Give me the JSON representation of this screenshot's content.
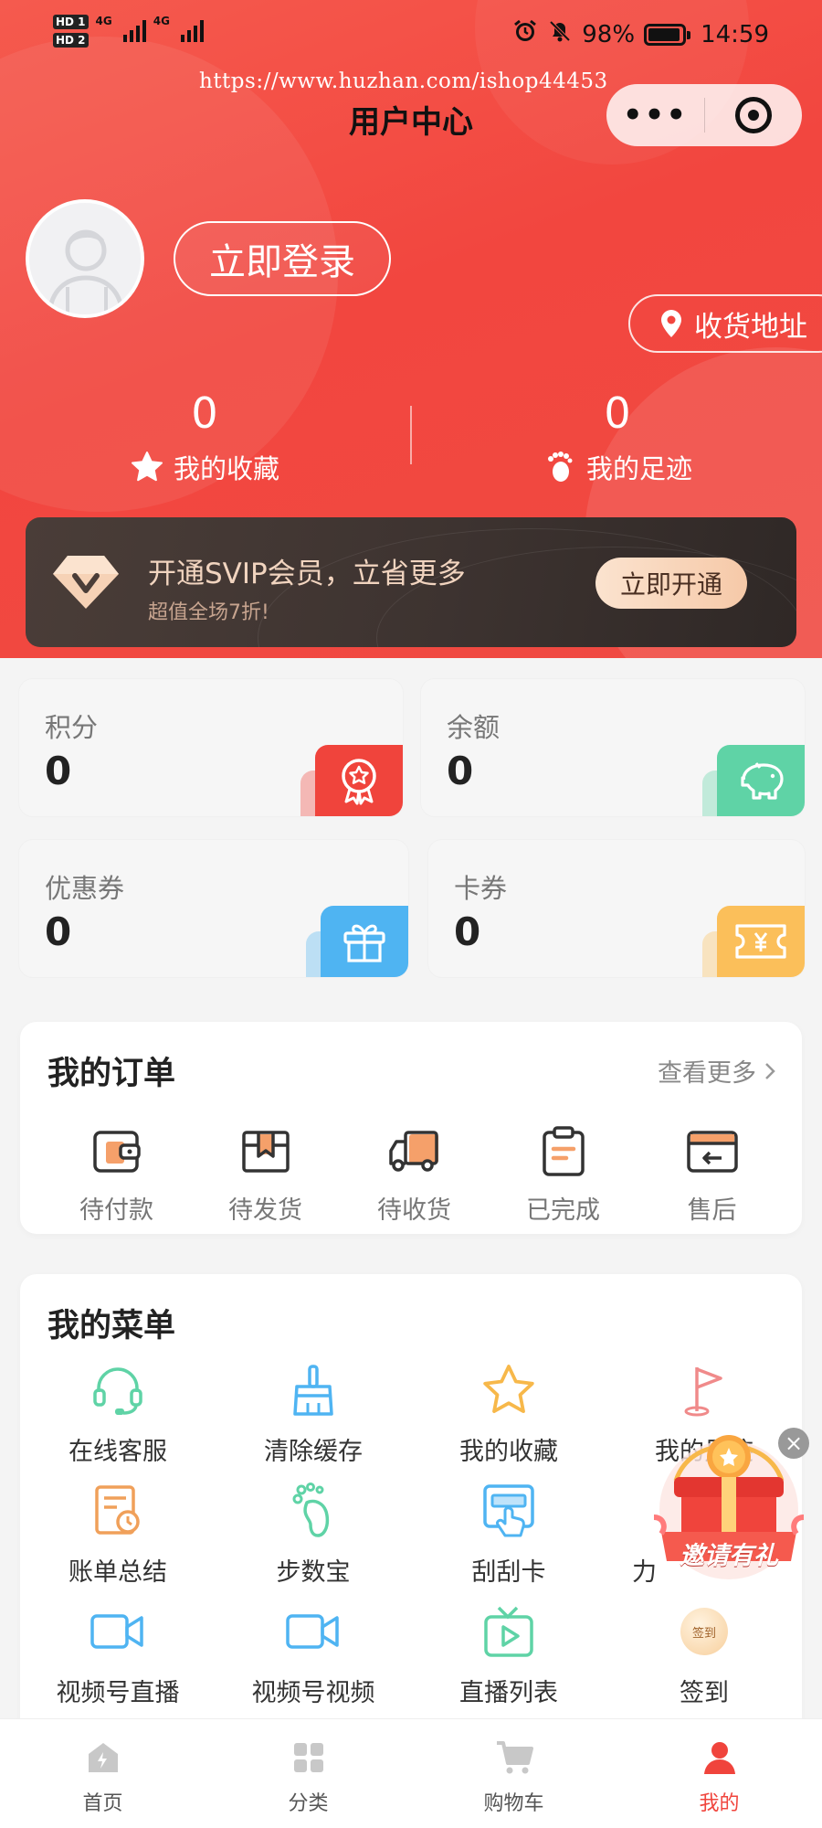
{
  "status_bar": {
    "hd1": "HD 1",
    "hd2": "HD 2",
    "net1": "4G",
    "net2": "4G",
    "battery": "98%",
    "time": "14:59"
  },
  "watermark": "https://www.huzhan.com/ishop44453",
  "header": {
    "title": "用户中心",
    "more_icon": "more-dots-icon",
    "close_icon": "target-icon",
    "login_label": "立即登录",
    "address_label": "收货地址"
  },
  "stats": {
    "favorites": {
      "value": "0",
      "label": "我的收藏"
    },
    "footprints": {
      "value": "0",
      "label": "我的足迹"
    }
  },
  "vip": {
    "title": "开通SVIP会员，立省更多",
    "subtitle": "超值全场7折!",
    "button": "立即开通"
  },
  "assets": [
    {
      "label": "积分",
      "value": "0",
      "color": "#f0443c"
    },
    {
      "label": "余额",
      "value": "0",
      "color": "#5fd3a6"
    },
    {
      "label": "优惠券",
      "value": "0",
      "color": "#4fb4f2"
    },
    {
      "label": "卡券",
      "value": "0",
      "color": "#fbbf5a"
    }
  ],
  "orders": {
    "title": "我的订单",
    "view_more": "查看更多",
    "items": [
      {
        "label": "待付款",
        "icon": "wallet-icon"
      },
      {
        "label": "待发货",
        "icon": "package-icon"
      },
      {
        "label": "待收货",
        "icon": "truck-icon"
      },
      {
        "label": "已完成",
        "icon": "clipboard-icon"
      },
      {
        "label": "售后",
        "icon": "return-card-icon"
      }
    ]
  },
  "menu": {
    "title": "我的菜单",
    "items": [
      {
        "label": "在线客服",
        "icon": "headset-icon"
      },
      {
        "label": "清除缓存",
        "icon": "broom-icon"
      },
      {
        "label": "我的收藏",
        "icon": "star-icon"
      },
      {
        "label": "我的足迹",
        "icon": "flag-icon"
      },
      {
        "label": "账单总结",
        "icon": "bill-clock-icon"
      },
      {
        "label": "步数宝",
        "icon": "footprint-icon"
      },
      {
        "label": "刮刮卡",
        "icon": "scratch-card-icon"
      },
      {
        "label": "力",
        "icon": "hidden-icon"
      },
      {
        "label": "视频号直播",
        "icon": "video-camera-icon"
      },
      {
        "label": "视频号视频",
        "icon": "video-camera-icon"
      },
      {
        "label": "直播列表",
        "icon": "tv-play-icon"
      },
      {
        "label": "签到",
        "icon": "sign-in-badge-icon",
        "badge": "签到"
      }
    ]
  },
  "invite": {
    "label": "邀请有礼"
  },
  "tabbar": [
    {
      "label": "首页",
      "icon": "home-icon",
      "active": false
    },
    {
      "label": "分类",
      "icon": "grid-icon",
      "active": false
    },
    {
      "label": "购物车",
      "icon": "cart-icon",
      "active": false
    },
    {
      "label": "我的",
      "icon": "user-icon",
      "active": true
    }
  ],
  "colors": {
    "brand_red": "#f2463f",
    "active_tab": "#f0443c",
    "vip_gold": "#f6c9a8"
  }
}
